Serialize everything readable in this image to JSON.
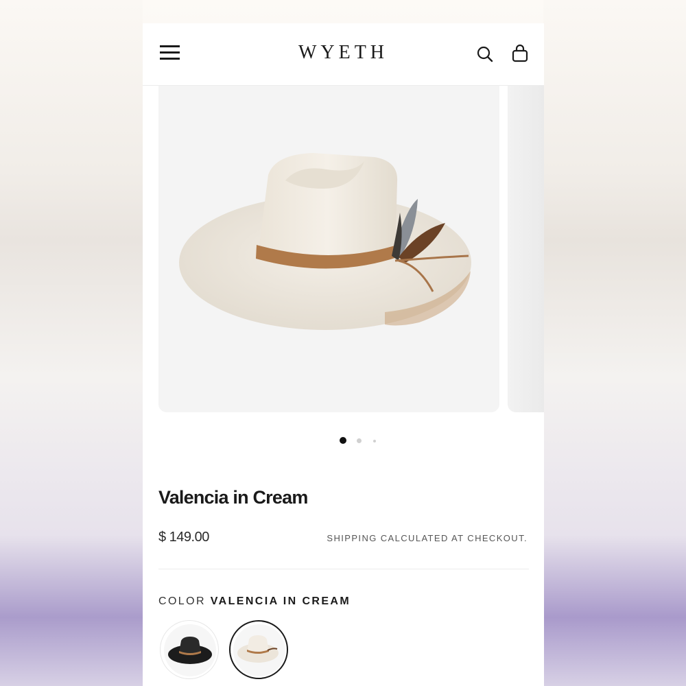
{
  "header": {
    "brand": "WYETH",
    "icons": [
      "menu-icon",
      "search-icon",
      "bag-icon"
    ]
  },
  "carousel": {
    "slide_count": 3,
    "active_index": 0
  },
  "product": {
    "title": "Valencia in Cream",
    "price": "$ 149.00",
    "shipping_note": "SHIPPING CALCULATED AT CHECKOUT.",
    "color_label": "COLOR",
    "color_value": "VALENCIA IN CREAM",
    "swatches": [
      {
        "name": "black hat",
        "selected": false
      },
      {
        "name": "cream hat",
        "selected": true
      }
    ]
  },
  "colors": {
    "hat_cream": "#efe9df",
    "band_tan": "#b07a4a",
    "text": "#1a1a1a",
    "dot_active": "#111111",
    "dot_inactive": "#d0d0d0"
  }
}
